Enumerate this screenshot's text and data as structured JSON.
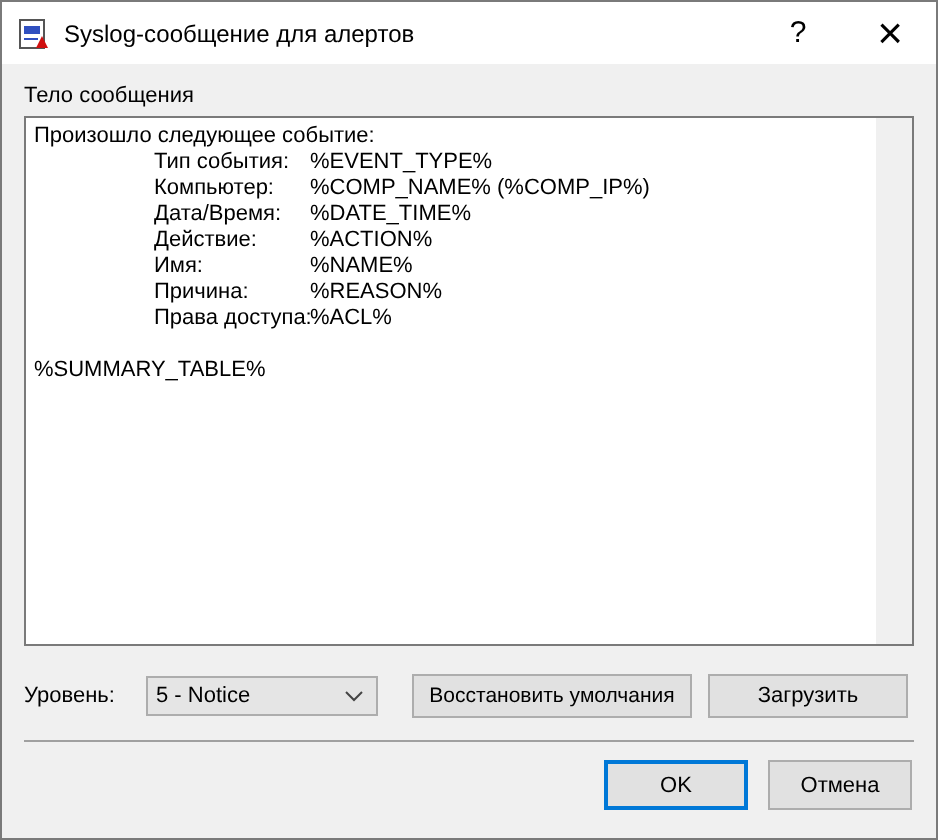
{
  "window": {
    "title": "Syslog-сообщение для алертов",
    "help": "?",
    "close": "×"
  },
  "message": {
    "label": "Тело сообщения",
    "intro": "Произошло следующее событие:",
    "fields": [
      {
        "label": "Тип события:",
        "value": "%EVENT_TYPE%"
      },
      {
        "label": "Компьютер:",
        "value": "%COMP_NAME% (%COMP_IP%)"
      },
      {
        "label": "Дата/Время:",
        "value": "%DATE_TIME%"
      },
      {
        "label": "Действие:",
        "value": "%ACTION%"
      },
      {
        "label": "Имя:",
        "value": "%NAME%"
      },
      {
        "label": "Причина:",
        "value": "%REASON%"
      },
      {
        "label": "Права доступа:",
        "value": "%ACL%"
      }
    ],
    "footer": "%SUMMARY_TABLE%"
  },
  "level": {
    "label": "Уровень:",
    "value": "5 - Notice"
  },
  "buttons": [
    {
      "label": "Восстановить умолчания",
      "kind": "secondary"
    },
    {
      "label": "Загрузить",
      "kind": "secondary"
    }
  ],
  "dialog_buttons": [
    {
      "label": "OK",
      "default": true
    },
    {
      "label": "Отмена",
      "default": false
    }
  ]
}
